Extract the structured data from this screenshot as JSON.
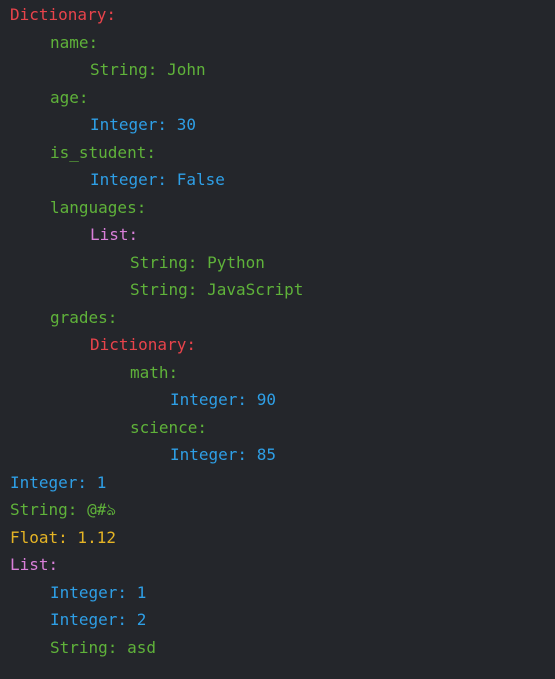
{
  "colors": {
    "background": "#24262b",
    "dictionary": "#e8434b",
    "string": "#5fb23a",
    "key": "#5fb23a",
    "integer": "#2e9fe6",
    "float": "#e5b425",
    "list": "#d97fd9"
  },
  "lines": [
    {
      "text": "Dictionary:",
      "kind": "dictionary",
      "indent": 0
    },
    {
      "text": "name:",
      "kind": "key",
      "indent": 1
    },
    {
      "text": "String: John",
      "kind": "string",
      "indent": 2
    },
    {
      "text": "age:",
      "kind": "key",
      "indent": 1
    },
    {
      "text": "Integer: 30",
      "kind": "integer",
      "indent": 2
    },
    {
      "text": "is_student:",
      "kind": "key",
      "indent": 1
    },
    {
      "text": "Integer: False",
      "kind": "integer",
      "indent": 2
    },
    {
      "text": "languages:",
      "kind": "key",
      "indent": 1
    },
    {
      "text": "List:",
      "kind": "list",
      "indent": 2
    },
    {
      "text": "String: Python",
      "kind": "string",
      "indent": 3
    },
    {
      "text": "String: JavaScript",
      "kind": "string",
      "indent": 3
    },
    {
      "text": "grades:",
      "kind": "key",
      "indent": 1
    },
    {
      "text": "Dictionary:",
      "kind": "dictionary",
      "indent": 2
    },
    {
      "text": "math:",
      "kind": "key",
      "indent": 3
    },
    {
      "text": "Integer: 90",
      "kind": "integer",
      "indent": 4
    },
    {
      "text": "science:",
      "kind": "key",
      "indent": 3
    },
    {
      "text": "Integer: 85",
      "kind": "integer",
      "indent": 4
    },
    {
      "text": "Integer: 1",
      "kind": "integer",
      "indent": 0
    },
    {
      "text": "String: @#ঌ",
      "kind": "string",
      "indent": 0
    },
    {
      "text": "Float: 1.12",
      "kind": "float",
      "indent": 0
    },
    {
      "text": "List:",
      "kind": "list",
      "indent": 0
    },
    {
      "text": "Integer: 1",
      "kind": "integer",
      "indent": 1
    },
    {
      "text": "Integer: 2",
      "kind": "integer",
      "indent": 1
    },
    {
      "text": "String: asd",
      "kind": "string",
      "indent": 1
    }
  ]
}
